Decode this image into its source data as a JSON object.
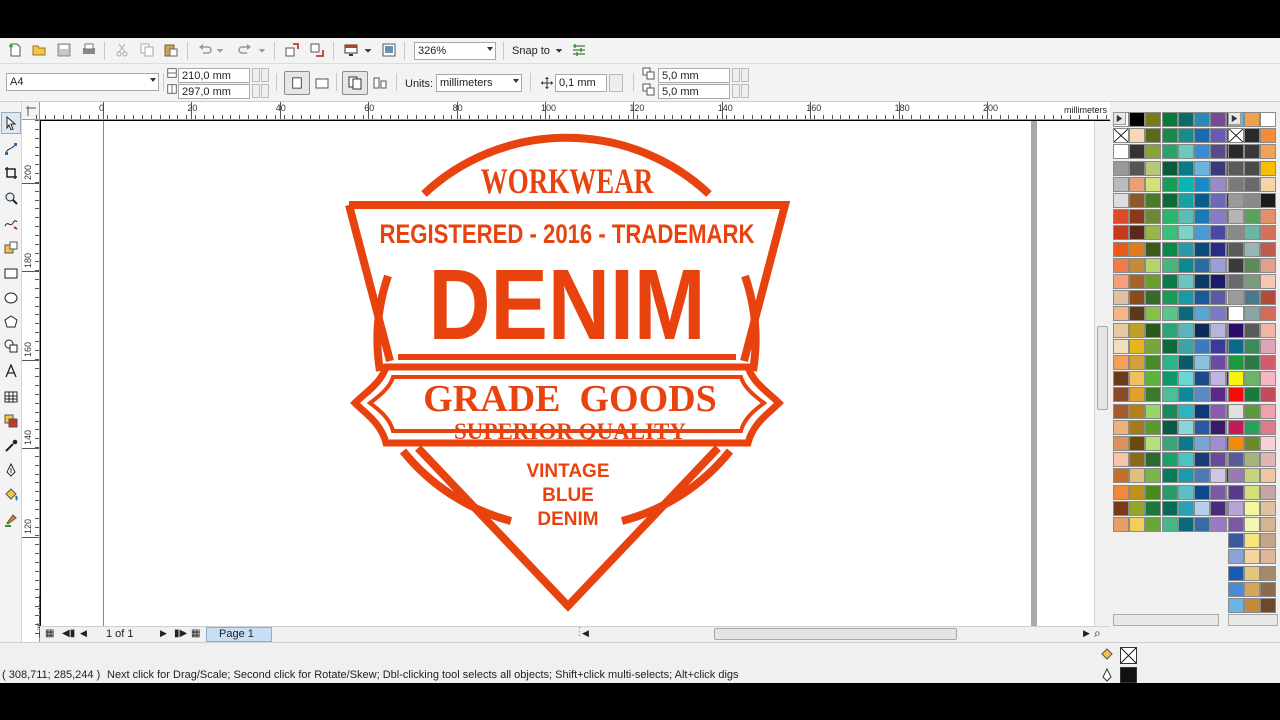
{
  "toolbar": {
    "zoom_value": "326%",
    "snap_to_label": "Snap to"
  },
  "property_bar": {
    "page_size": "A4",
    "page_width": "210,0 mm",
    "page_height": "297,0 mm",
    "units_label": "Units:",
    "units_value": "millimeters",
    "nudge_value": "0,1 mm",
    "duplicate_x": "5,0 mm",
    "duplicate_y": "5,0 mm"
  },
  "rulers": {
    "horizontal_labels": [
      "0",
      "20",
      "40",
      "60",
      "80",
      "100",
      "120",
      "140",
      "160",
      "180",
      "200"
    ],
    "vertical_labels": [
      "200",
      "180",
      "160",
      "140",
      "120"
    ],
    "unit_label": "millimeters"
  },
  "logo": {
    "brand_color": "#e8430e",
    "top_text": "WORKWEAR",
    "registered_line": "REGISTERED - 2016 - TRADEMARK",
    "main_text": "DENIM",
    "banner_text": "GRADE  GOODS",
    "banner_subtext": "SUPERIOR QUALITY",
    "bottom_lines": [
      "VINTAGE",
      "BLUE",
      "DENIM"
    ]
  },
  "page_navigator": {
    "page_count": "1 of 1",
    "current_page_tab": "Page 1"
  },
  "status_bar": {
    "coordinates": "( 308,711; 285,244 )",
    "hint": "Next click for Drag/Scale; Second click for Rotate/Skew; Dbl-clicking tool selects all objects; Shift+click multi-selects; Alt+click digs"
  },
  "colors": {
    "toolbar_bg": "#f3f3f3",
    "page_tab_bg": "#c7def4",
    "accent": "#e8430e"
  }
}
